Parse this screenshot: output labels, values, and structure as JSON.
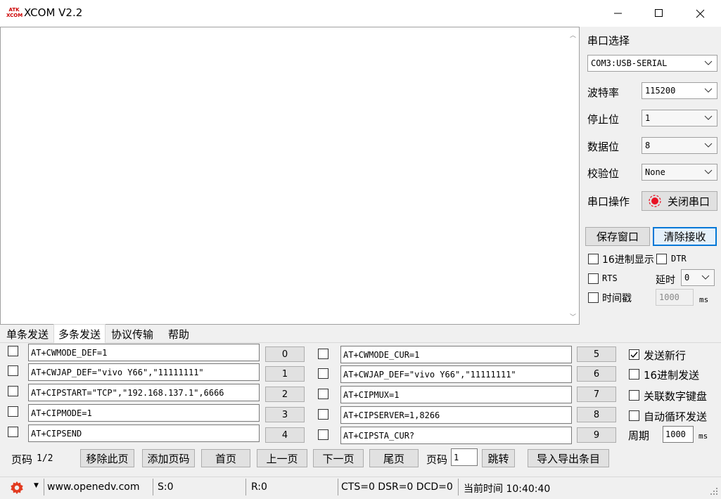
{
  "window": {
    "title": "XCOM V2.2",
    "logo_text": "ATK XCOM"
  },
  "serial": {
    "port_label": "串口选择",
    "port_value": "COM3:USB-SERIAL",
    "baud_label": "波特率",
    "baud_value": "115200",
    "stop_label": "停止位",
    "stop_value": "1",
    "data_label": "数据位",
    "data_value": "8",
    "parity_label": "校验位",
    "parity_value": "None",
    "op_label": "串口操作",
    "close_btn": "关闭串口",
    "save_btn": "保存窗口",
    "clear_btn": "清除接收",
    "hex_display": "16进制显示",
    "dtr": "DTR",
    "rts": "RTS",
    "delay_label": "延时",
    "delay_value": "0",
    "timestamp_label": "时间戳",
    "timestamp_value": "1000",
    "ms": "ms"
  },
  "tabs": [
    "单条发送",
    "多条发送",
    "协议传输",
    "帮助"
  ],
  "rows_left": [
    {
      "text": "AT+CWMODE_DEF=1",
      "btn": "0"
    },
    {
      "text": "AT+CWJAP_DEF=\"vivo Y66\",\"11111111\"",
      "btn": "1"
    },
    {
      "text": "AT+CIPSTART=\"TCP\",\"192.168.137.1\",6666",
      "btn": "2"
    },
    {
      "text": "AT+CIPMODE=1",
      "btn": "3"
    },
    {
      "text": "AT+CIPSEND",
      "btn": "4"
    }
  ],
  "rows_right": [
    {
      "text": "AT+CWMODE_CUR=1",
      "btn": "5"
    },
    {
      "text": "AT+CWJAP_DEF=\"vivo Y66\",\"11111111\"",
      "btn": "6"
    },
    {
      "text": "AT+CIPMUX=1",
      "btn": "7"
    },
    {
      "text": "AT+CIPSERVER=1,8266",
      "btn": "8"
    },
    {
      "text": "AT+CIPSTA_CUR?",
      "btn": "9"
    }
  ],
  "options": {
    "send_newline": "发送新行",
    "hex_send": "16进制发送",
    "link_keypad": "关联数字键盘",
    "auto_loop": "自动循环发送",
    "period_label": "周期",
    "period_value": "1000",
    "ms": "ms"
  },
  "pager": {
    "page_label": "页码",
    "page_value": "1/2",
    "remove_page": "移除此页",
    "add_page": "添加页码",
    "first": "首页",
    "prev": "上一页",
    "next": "下一页",
    "last": "尾页",
    "goto_label": "页码",
    "goto_value": "1",
    "jump": "跳转",
    "import_export": "导入导出条目"
  },
  "status": {
    "website": "www.openedv.com",
    "sent": "S:0",
    "received": "R:0",
    "lines": "CTS=0 DSR=0 DCD=0",
    "time": "当前时间 10:40:40"
  },
  "colors": {
    "accent_border": "#0078d7",
    "gear": "#e23a1f",
    "led_red": "#e81123"
  }
}
